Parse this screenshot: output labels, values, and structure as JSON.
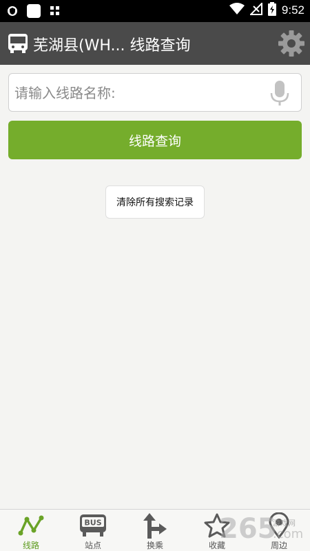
{
  "status_bar": {
    "time": "9:52"
  },
  "app_bar": {
    "title": "芜湖县(WH... 线路查询"
  },
  "search": {
    "placeholder": "请输入线路名称:",
    "value": ""
  },
  "query_button": {
    "label": "线路查询"
  },
  "clear_button": {
    "label": "清除所有搜索记录"
  },
  "bottom_nav": {
    "items": [
      {
        "label": "线路",
        "icon": "route-line-icon",
        "active": true
      },
      {
        "label": "站点",
        "icon": "bus-stop-icon",
        "active": false
      },
      {
        "label": "换乘",
        "icon": "transfer-arrow-icon",
        "active": false
      },
      {
        "label": "收藏",
        "icon": "star-icon",
        "active": false
      },
      {
        "label": "周边",
        "icon": "location-pin-icon",
        "active": false
      }
    ]
  },
  "watermark": {
    "number": "265",
    "text": "游戏网",
    "suffix": ".com"
  },
  "colors": {
    "accent": "#75ad2c",
    "app_bar": "#4a4a4a",
    "background": "#f4f4f2",
    "active_nav": "#5d9b1e"
  }
}
